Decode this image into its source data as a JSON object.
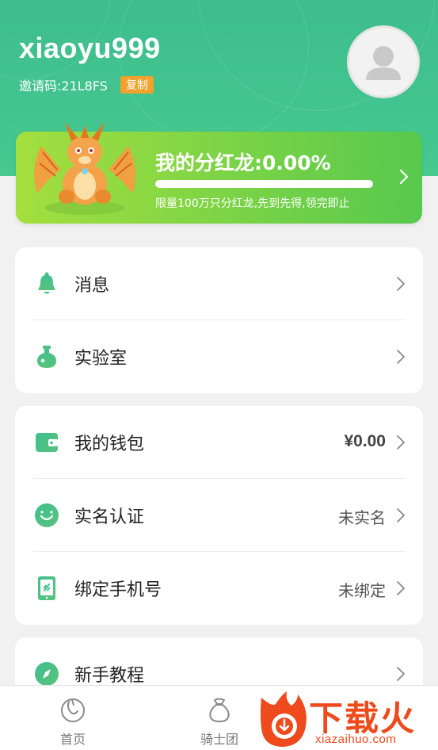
{
  "profile": {
    "username": "xiaoyu999",
    "invite_code_text": "邀请码:21L8FS",
    "copy_label": "复制"
  },
  "dragon": {
    "title": "我的分红龙:0.00%",
    "progress": 0.0,
    "subtitle": "限量100万只分红龙,先到先得,领完即止"
  },
  "card1": {
    "items": [
      {
        "label": "消息",
        "icon": "bell-icon"
      },
      {
        "label": "实验室",
        "icon": "flask-icon"
      }
    ]
  },
  "card2": {
    "items": [
      {
        "label": "我的钱包",
        "value": "¥0.00",
        "icon": "wallet-icon"
      },
      {
        "label": "实名认证",
        "value": "未实名",
        "icon": "smile-face-icon"
      },
      {
        "label": "绑定手机号",
        "value": "未绑定",
        "icon": "phone-link-icon"
      }
    ]
  },
  "card3": {
    "items": [
      {
        "label": "新手教程",
        "icon": "compass-icon"
      }
    ]
  },
  "bottom_nav": {
    "items": [
      {
        "label": "首页",
        "icon": "home-dragon-icon"
      },
      {
        "label": "骑士团",
        "icon": "bag-icon"
      }
    ]
  },
  "watermark": {
    "big": "下载火",
    "small": "xiazaihuo.com"
  },
  "colors": {
    "header_green": "#3dbd8e",
    "accent_green": "#46c98f",
    "copy_orange": "#f2a22c",
    "watermark_red": "#ee4a1c"
  }
}
